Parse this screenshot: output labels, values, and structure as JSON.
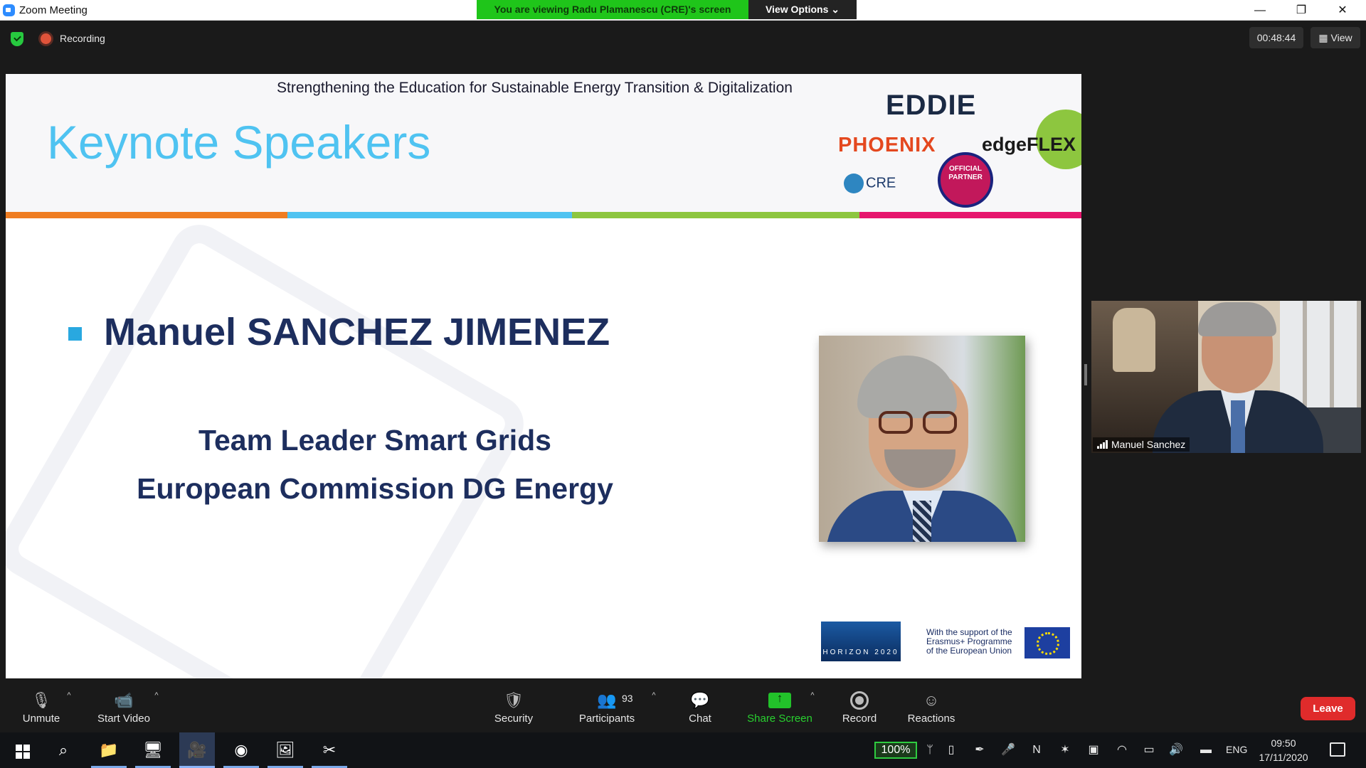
{
  "window": {
    "title": "Zoom Meeting",
    "viewing_banner": "You are viewing Radu Plamanescu (CRE)'s screen",
    "view_options": "View Options ⌄",
    "minimize": "—",
    "restore": "❐",
    "close": "✕"
  },
  "meeting": {
    "recording_label": "Recording",
    "timer": "00:48:44",
    "view_label": "View"
  },
  "slide": {
    "subtitle": "Strengthening the Education for Sustainable Energy Transition & Digitalization",
    "title": "Keynote Speakers",
    "speaker_name": "Manuel SANCHEZ JIMENEZ",
    "speaker_role_1": "Team Leader Smart Grids",
    "speaker_role_2": "European Commission DG Energy",
    "logo_eddie": "EDDIE",
    "logo_phoenix": "PHOENIX",
    "logo_edgeflex": "edgeFLEX",
    "logo_cre": "CRE",
    "badge_partner": "OFFICIAL PARTNER",
    "horizon_label": "HORIZON 2020",
    "erasmus_text": "With the support of the Erasmus+ Programme of the European Union",
    "stripe_colors": [
      "#ef7d22",
      "#4fc3f1",
      "#8dc63f",
      "#e6156d"
    ]
  },
  "participant_video": {
    "name": "Manuel Sanchez"
  },
  "toolbar": {
    "unmute": "Unmute",
    "start_video": "Start Video",
    "security": "Security",
    "participants": "Participants",
    "participants_count": "93",
    "chat": "Chat",
    "share_screen": "Share Screen",
    "record": "Record",
    "reactions": "Reactions",
    "leave": "Leave"
  },
  "taskbar": {
    "battery_pct": "100%",
    "lang": "ENG",
    "time": "09:50",
    "date": "17/11/2020",
    "icons": [
      "search-icon",
      "file-explorer-icon",
      "remote-desktop-icon",
      "zoom-icon",
      "chrome-icon",
      "photos-icon",
      "snip-icon"
    ]
  }
}
